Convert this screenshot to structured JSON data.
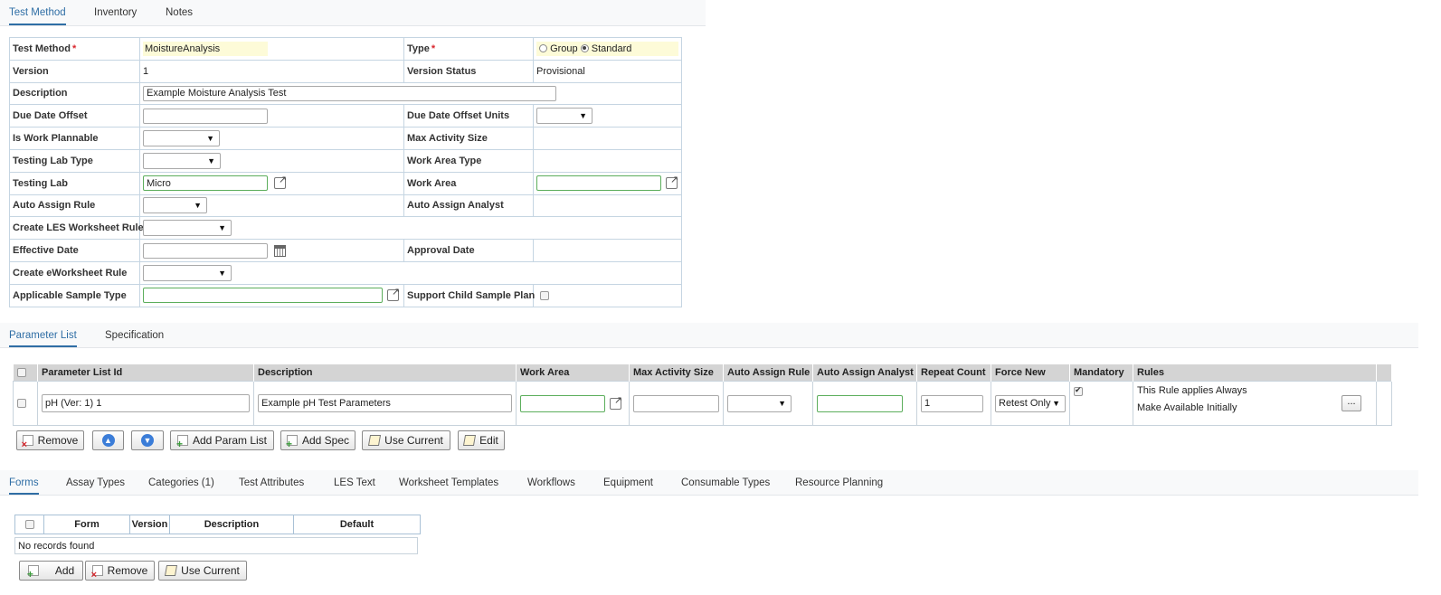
{
  "top_tabs": [
    "Test Method",
    "Inventory",
    "Notes"
  ],
  "form": {
    "test_method_label": "Test Method",
    "test_method_value": "MoistureAnalysis",
    "type_label": "Type",
    "type_group": "Group",
    "type_standard": "Standard",
    "type_selected": "Standard",
    "version_label": "Version",
    "version_value": "1",
    "version_status_label": "Version Status",
    "version_status_value": "Provisional",
    "description_label": "Description",
    "description_value": "Example Moisture Analysis Test",
    "due_date_offset_label": "Due Date Offset",
    "due_date_offset_units_label": "Due Date Offset Units",
    "is_work_plannable_label": "Is Work Plannable",
    "max_activity_size_label": "Max Activity Size",
    "testing_lab_type_label": "Testing Lab Type",
    "work_area_type_label": "Work Area Type",
    "testing_lab_label": "Testing Lab",
    "testing_lab_value": "Micro",
    "work_area_label": "Work Area",
    "auto_assign_rule_label": "Auto Assign Rule",
    "auto_assign_analyst_label": "Auto Assign Analyst",
    "create_les_label": "Create LES Worksheet Rule",
    "effective_date_label": "Effective Date",
    "approval_date_label": "Approval Date",
    "create_eworksheet_label": "Create eWorksheet Rule",
    "applicable_sample_type_label": "Applicable Sample Type",
    "support_child_label": "Support Child Sample Plan"
  },
  "param_tabs": [
    "Parameter List",
    "Specification"
  ],
  "param_grid": {
    "columns": [
      "Parameter List Id",
      "Description",
      "Work Area",
      "Max Activity Size",
      "Auto Assign Rule",
      "Auto Assign Analyst",
      "Repeat Count",
      "Force New",
      "Mandatory",
      "Rules"
    ],
    "row": {
      "param_list_id": "pH (Ver: 1) 1",
      "description": "Example pH Test Parameters",
      "repeat_count": "1",
      "force_new": "Retest Only",
      "mandatory": true,
      "rule_1": "This Rule applies Always",
      "rule_2": "Make Available Initially",
      "ellipsis": "..."
    }
  },
  "param_buttons": {
    "remove": "Remove",
    "add_param_list": "Add Param List",
    "add_spec": "Add Spec",
    "use_current": "Use Current",
    "edit": "Edit"
  },
  "bottom_tabs": [
    "Forms",
    "Assay Types",
    "Categories (1)",
    "Test Attributes",
    "LES Text",
    "Worksheet Templates",
    "Workflows",
    "Equipment",
    "Consumable Types",
    "Resource Planning"
  ],
  "forms_grid": {
    "columns": [
      "Form",
      "Version",
      "Description",
      "Default"
    ],
    "empty_text": "No records found"
  },
  "forms_buttons": {
    "add": "Add",
    "remove": "Remove",
    "use_current": "Use Current"
  },
  "colors": {
    "accent": "#2f6ea5",
    "required": "#d9272e",
    "highlight": "#fdfbd8",
    "valid_border": "#5cae5c"
  }
}
